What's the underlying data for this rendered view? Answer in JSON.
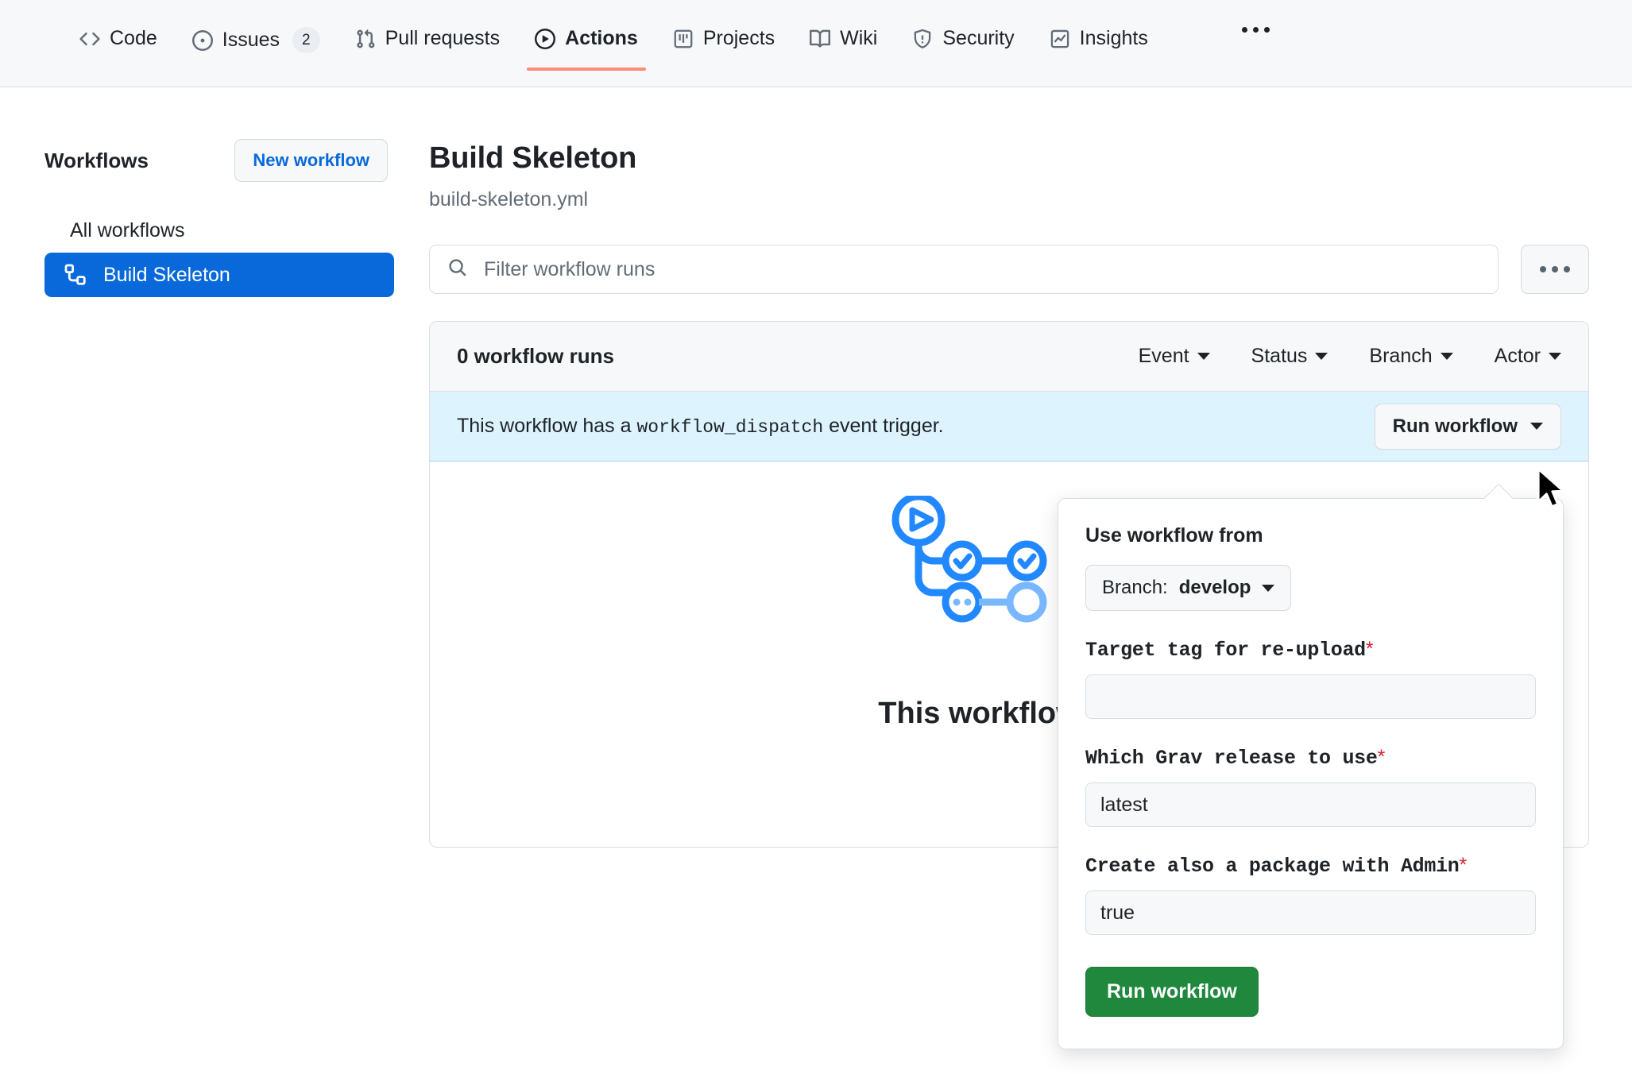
{
  "repo_nav": {
    "items": [
      {
        "label": "Code",
        "icon": "code-icon",
        "active": false,
        "count": null
      },
      {
        "label": "Issues",
        "icon": "issue-opened-icon",
        "active": false,
        "count": "2"
      },
      {
        "label": "Pull requests",
        "icon": "git-pull-request-icon",
        "active": false,
        "count": null
      },
      {
        "label": "Actions",
        "icon": "play-circle-icon",
        "active": true,
        "count": null
      },
      {
        "label": "Projects",
        "icon": "project-board-icon",
        "active": false,
        "count": null
      },
      {
        "label": "Wiki",
        "icon": "book-icon",
        "active": false,
        "count": null
      },
      {
        "label": "Security",
        "icon": "shield-icon",
        "active": false,
        "count": null
      },
      {
        "label": "Insights",
        "icon": "graph-icon",
        "active": false,
        "count": null
      }
    ],
    "overflow_icon": "kebab-horizontal-icon",
    "active_underline_color": "#fd8c73"
  },
  "sidebar": {
    "title": "Workflows",
    "new_workflow_label": "New workflow",
    "items": [
      {
        "label": "All workflows",
        "icon": null,
        "selected": false
      },
      {
        "label": "Build Skeleton",
        "icon": "workflow-icon",
        "selected": true
      }
    ],
    "selected_color": "#0969da"
  },
  "main": {
    "page_title": "Build Skeleton",
    "page_subtitle": "build-skeleton.yml",
    "filter": {
      "icon": "search-icon",
      "placeholder": "Filter workflow runs",
      "value": ""
    },
    "kebab_label": "…"
  },
  "runs": {
    "count_label": "0 workflow runs",
    "filters": [
      {
        "label": "Event"
      },
      {
        "label": "Status"
      },
      {
        "label": "Branch"
      },
      {
        "label": "Actor"
      }
    ],
    "banner": {
      "prefix": "This workflow has a",
      "code": "workflow_dispatch",
      "suffix": "event trigger.",
      "button_label": "Run workflow",
      "background_color": "#ddf4ff"
    },
    "empty_state": {
      "illustration": "actions-workflow-graph-illustration",
      "heading": "This workflow has"
    }
  },
  "dispatch_panel": {
    "title": "Use workflow from",
    "branch_select": {
      "prefix": "Branch:",
      "value": "develop",
      "icon": "chevron-down-icon"
    },
    "fields": [
      {
        "label": "Target tag for re-upload",
        "required_marker": "*",
        "value": "",
        "placeholder": ""
      },
      {
        "label": "Which Grav release to use",
        "required_marker": "*",
        "value": "latest",
        "placeholder": ""
      },
      {
        "label": "Create also a package with Admin",
        "required_marker": "*",
        "value": "true",
        "placeholder": ""
      }
    ],
    "submit_label": "Run workflow",
    "submit_color": "#1f883d",
    "required_color": "#cf222e"
  },
  "cursor": {
    "icon": "mouse-pointer-icon"
  }
}
